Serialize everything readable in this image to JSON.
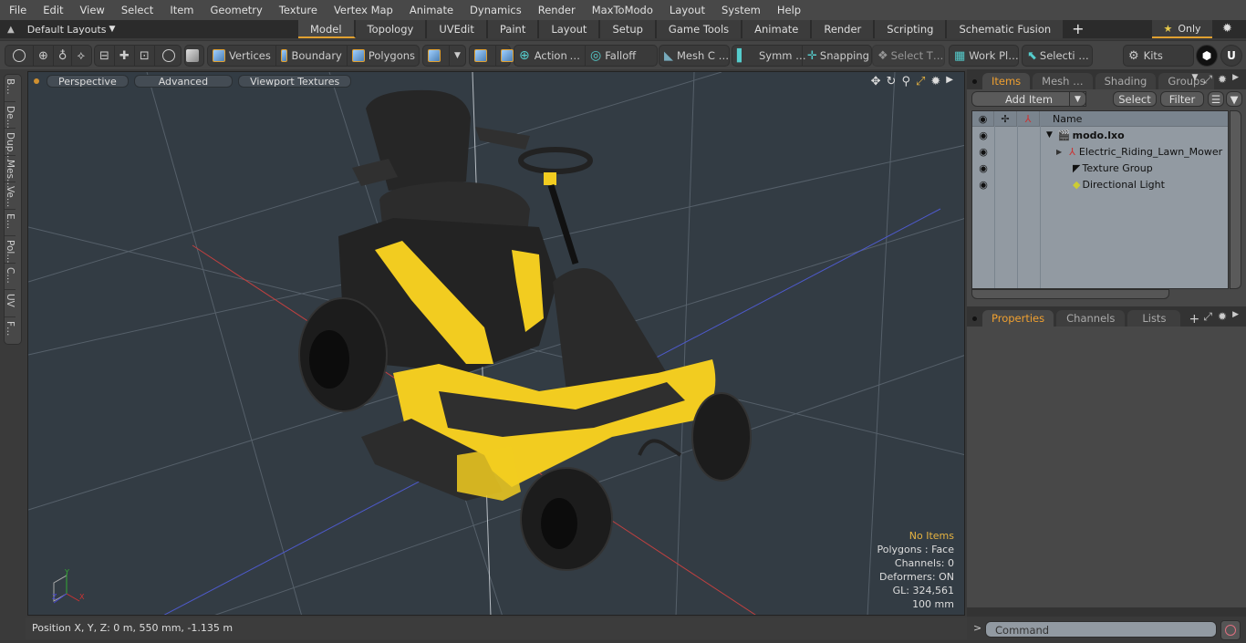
{
  "menu": [
    "File",
    "Edit",
    "View",
    "Select",
    "Item",
    "Geometry",
    "Texture",
    "Vertex Map",
    "Animate",
    "Dynamics",
    "Render",
    "MaxToModo",
    "Layout",
    "System",
    "Help"
  ],
  "layouts": {
    "label": "Default Layouts",
    "dropdown_icon": "triangle-down-icon"
  },
  "mode_tabs": [
    {
      "label": "Model",
      "active": true
    },
    {
      "label": "Topology"
    },
    {
      "label": "UVEdit"
    },
    {
      "label": "Paint"
    },
    {
      "label": "Layout"
    },
    {
      "label": "Setup"
    },
    {
      "label": "Game Tools"
    },
    {
      "label": "Animate"
    },
    {
      "label": "Render"
    },
    {
      "label": "Scripting"
    },
    {
      "label": "Schematic Fusion"
    }
  ],
  "only_label": "Only",
  "toolbar": {
    "vertices": "Vertices",
    "boundary": "Boundary",
    "polygons": "Polygons",
    "action": "Action",
    "action_more": "…",
    "falloff": "Falloff",
    "mesh": "Mesh C …",
    "symm": "Symm …",
    "snapping": "Snapping",
    "select_t": "Select T…",
    "work_plane": "Work Pl…",
    "selection": "Selecti …",
    "kits": "Kits"
  },
  "side_tabs": [
    "B…",
    "De…",
    "Dup…",
    "Mes…",
    "Ve…",
    "E…",
    "Pol…",
    "C…",
    "UV",
    "F…"
  ],
  "viewport": {
    "perspective": "Perspective",
    "advanced": "Advanced",
    "textures": "Viewport Textures",
    "stats": {
      "selection": "No Items",
      "polygons": "Polygons : Face",
      "channels": "Channels: 0",
      "deformers": "Deformers: ON",
      "gl": "GL: 324,561",
      "unit": "100 mm"
    },
    "colors": {
      "bg": "#333c44",
      "mower_yellow": "#f2cc20",
      "mower_black": "#2a2a2a"
    }
  },
  "status": {
    "position": "Position X, Y, Z:   0 m, 550 mm, -1.135 m"
  },
  "items_panel": {
    "tabs": [
      {
        "label": "Items",
        "active": true
      },
      {
        "label": "Mesh …"
      },
      {
        "label": "Shading"
      },
      {
        "label": "Groups"
      }
    ],
    "add_item": "Add Item",
    "select": "Select",
    "filter": "Filter",
    "name_header": "Name",
    "tree": [
      {
        "label": "modo.lxo",
        "bold": true,
        "icon": "scene-icon"
      },
      {
        "label": "Electric_Riding_Lawn_Mower",
        "icon": "mesh-locator-icon"
      },
      {
        "label": "Texture Group",
        "icon": "texture-group-icon"
      },
      {
        "label": "Directional Light",
        "icon": "light-icon"
      }
    ]
  },
  "props_panel": {
    "tabs": [
      {
        "label": "Properties",
        "active": true
      },
      {
        "label": "Channels"
      },
      {
        "label": "Lists"
      }
    ],
    "add": "+"
  },
  "command": {
    "prompt": ">",
    "placeholder": "Command"
  }
}
